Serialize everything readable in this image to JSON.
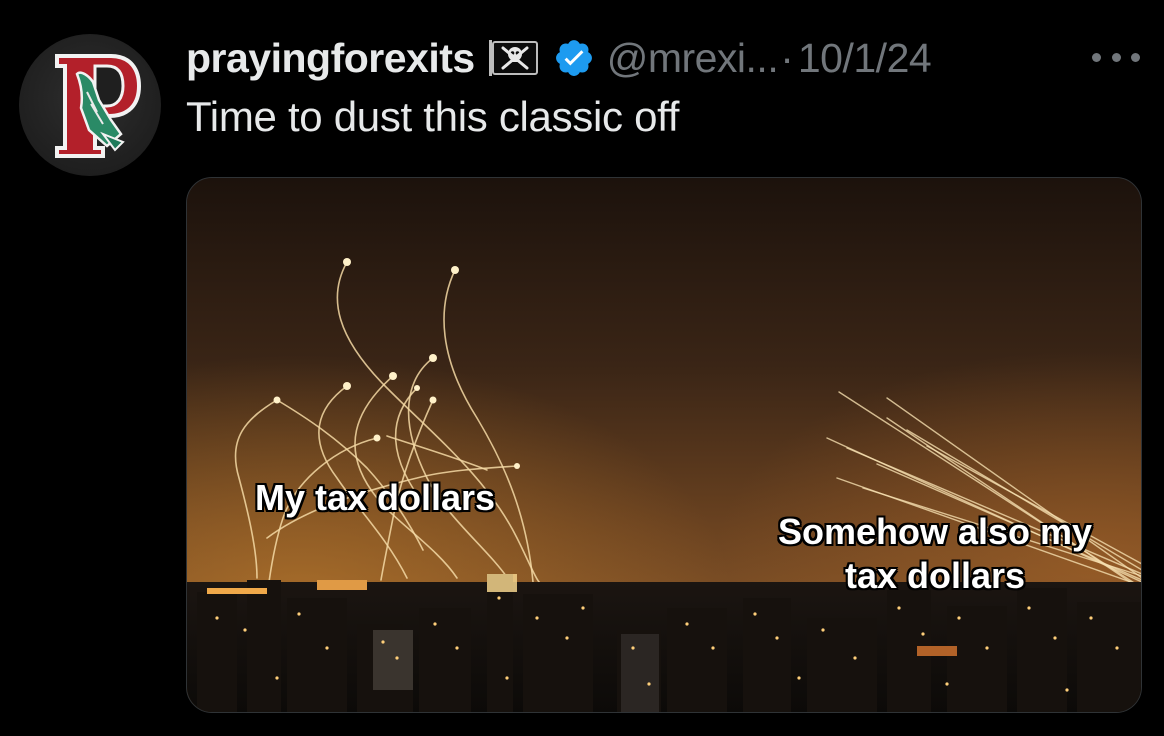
{
  "tweet": {
    "display_name": "prayingforexits",
    "handle": "@mrexi...",
    "separator": "·",
    "date": "10/1/24",
    "text": "Time to dust this classic off"
  },
  "icons": {
    "avatar": "praying-hands-letter-p-avatar",
    "flag": "pirate-flag-emoji-icon",
    "verified": "verified-badge-icon",
    "more": "more-options-icon"
  },
  "colors": {
    "background": "#000000",
    "primary_text": "#e7e9ea",
    "secondary_text": "#71767b",
    "verified_blue": "#1d9bf0",
    "avatar_letter_red": "#b3202a",
    "avatar_hands_green": "#1f7a5a"
  },
  "meme": {
    "caption_left": "My tax dollars",
    "caption_right": "Somehow also my tax dollars"
  }
}
